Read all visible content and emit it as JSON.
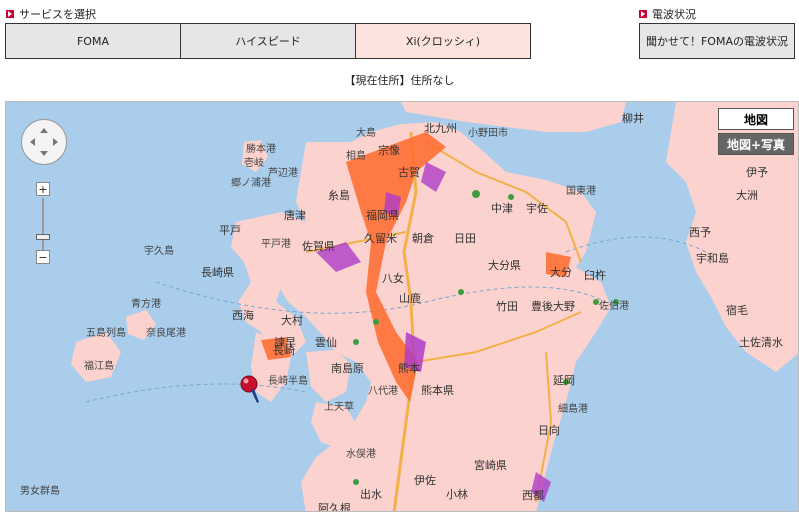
{
  "service": {
    "heading": "サービスを選択",
    "tabs": [
      {
        "label": "FOMA"
      },
      {
        "label": "ハイスピード"
      },
      {
        "label": "Xi(クロッシィ)"
      }
    ],
    "selected_index": 2
  },
  "status": {
    "heading": "電波状況",
    "button_label": "聞かせて！FOMAの電波状況"
  },
  "address": {
    "label": "【現在住所】",
    "value": "住所なし"
  },
  "map": {
    "type_controls": {
      "map": "地図",
      "hybrid": "地図+写真"
    },
    "zoom": {
      "in": "+",
      "out": "−"
    },
    "colors": {
      "sea": "#a9cdeb",
      "land": "#fbd2cd",
      "coverage_xi": "#ff6a2b",
      "coverage_hspa": "#b03cc8",
      "coverage_green": "#3f9b3f"
    },
    "labels": {
      "ojima": "大島",
      "kitakyushu": "北九州",
      "kokura": "小野田市",
      "yanai": "柳井",
      "munakata": "宗像",
      "aiyanoshima": "相島",
      "kasuya": "古賀",
      "iki": "壱岐",
      "katsumoto": "勝本港",
      "ashibe": "芦辺港",
      "gotsu": "郷ノ浦港",
      "itoshima": "糸島",
      "fukuokaken": "福岡県",
      "karatsu": "唐津",
      "hirado": "平戸",
      "sagaken": "佐賀県",
      "kurume": "久留米",
      "asakura": "朝倉",
      "hita": "日田",
      "usa": "宇佐",
      "kunisaki": "国東港",
      "nakatsu": "中津",
      "ukushima": "宇久島",
      "tabirahigashi": "平戸港",
      "nagasakiken": "長崎県",
      "yame": "八女",
      "oitaken": "大分県",
      "oita": "大分",
      "usuki": "臼杵",
      "iyo": "伊予",
      "ozu": "大洲",
      "nishinomiya": "西予",
      "uwajima": "宇和島",
      "aoka": "青方港",
      "saikai": "西海",
      "omura": "大村",
      "yamaga": "山鹿",
      "taketa": "竹田",
      "bungoono": "豊後大野",
      "saiki": "佐伯港",
      "sukumo": "宿毛",
      "tosashimizu": "土佐清水",
      "goto": "五島列島",
      "narao": "奈良尾港",
      "isahaya": "諫早",
      "fukuejima": "福江島",
      "nagasaki": "長崎",
      "unzen": "雲仙",
      "kumamoto": "熊本",
      "nagasakihanto": "長崎半島",
      "shimabara": "南島原",
      "kumamotoken": "熊本県",
      "amakusa": "八代港",
      "nobeoka": "延岡",
      "hosojima": "細島港",
      "hyuga": "日向",
      "kamiamakusa": "上天草",
      "minamata": "水俣港",
      "miyazakiken": "宮崎県",
      "danjo": "男女群島",
      "izumi": "出水",
      "isa": "伊佐",
      "kobayashi": "小林",
      "akune": "阿久根",
      "saito": "西都"
    }
  }
}
